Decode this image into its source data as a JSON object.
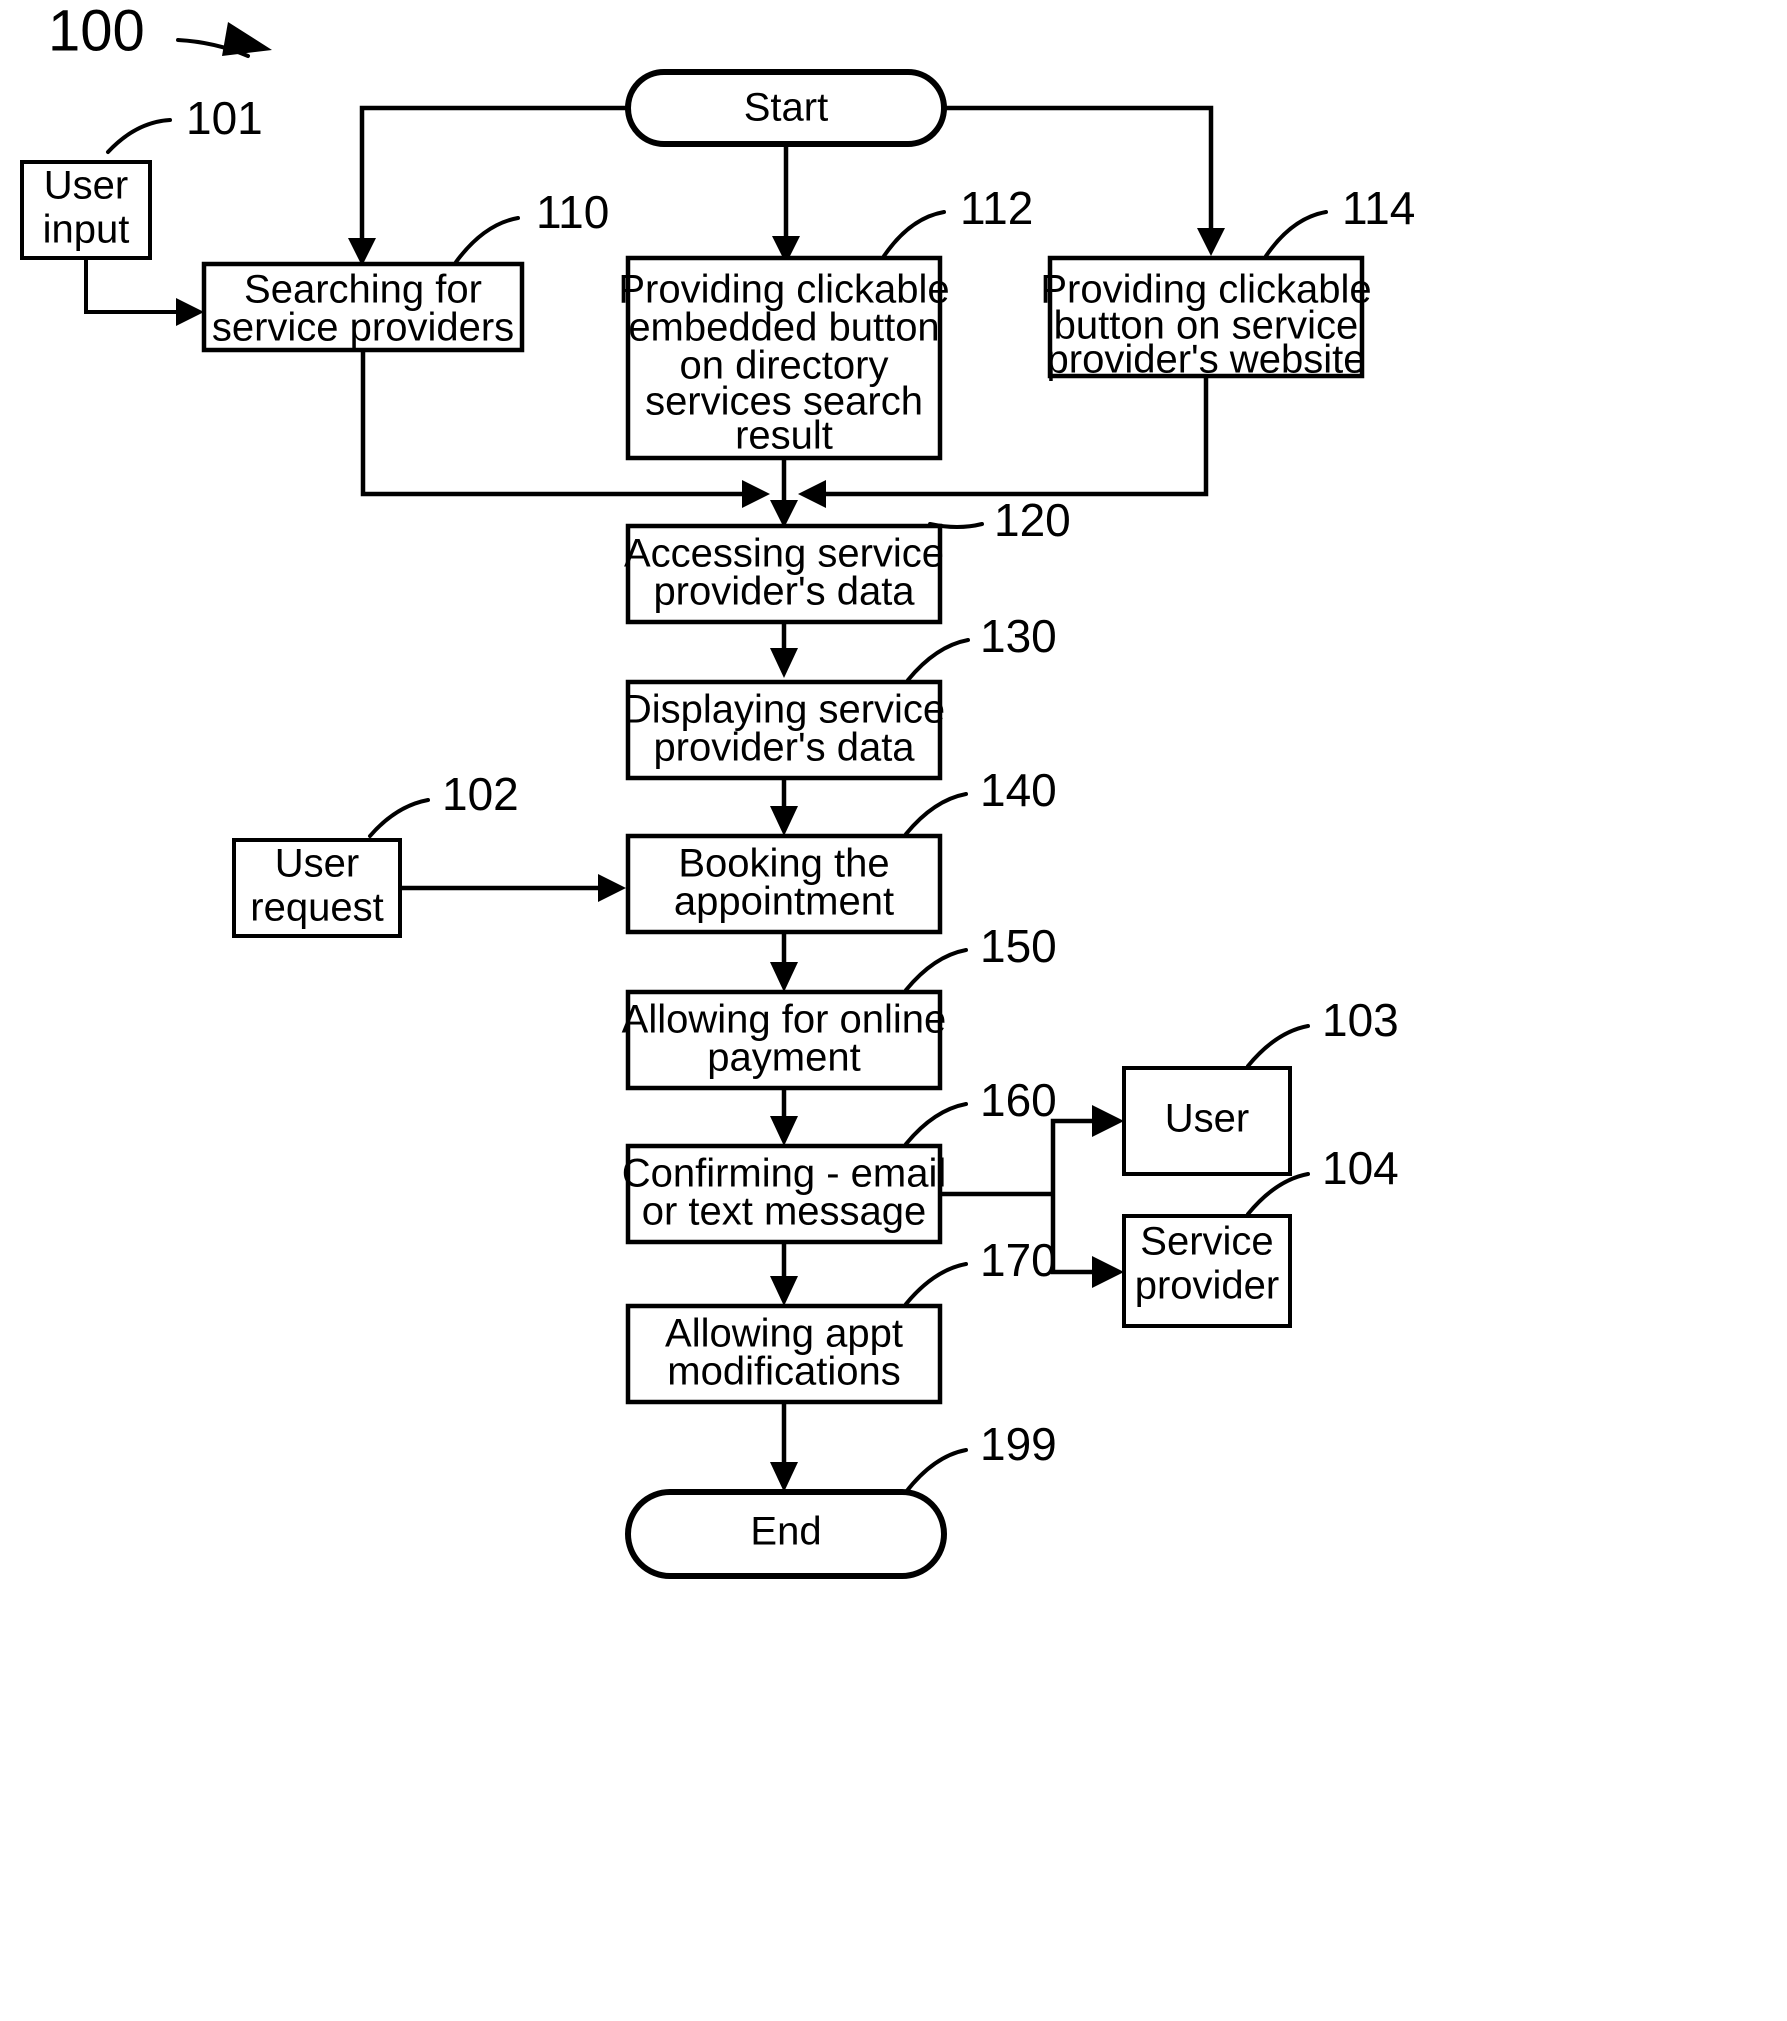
{
  "figure": {
    "number": "100",
    "title_marker": "100"
  },
  "terminals": [
    {
      "id": "start",
      "label": "Start",
      "ref": ""
    },
    {
      "id": "end",
      "label": "End",
      "ref": "199"
    }
  ],
  "nodes": [
    {
      "id": "user-input",
      "ref": "101",
      "lines": [
        "User",
        "input"
      ],
      "kind": "actor"
    },
    {
      "id": "searching-for-service-providers",
      "ref": "110",
      "lines": [
        "Searching for",
        "service providers"
      ],
      "kind": "process"
    },
    {
      "id": "providing-clickable-embedded-button",
      "ref": "112",
      "lines": [
        "Providing clickable",
        "embedded button",
        "on directory",
        "services search",
        "result"
      ],
      "kind": "process"
    },
    {
      "id": "providing-clickable-button-website",
      "ref": "114",
      "lines": [
        "Providing clickable",
        "button on service",
        "provider's website"
      ],
      "kind": "process"
    },
    {
      "id": "accessing-service-providers-data",
      "ref": "120",
      "lines": [
        "Accessing service",
        "provider's data"
      ],
      "kind": "process"
    },
    {
      "id": "displaying-service-providers-data",
      "ref": "130",
      "lines": [
        "Displaying service",
        "provider's data"
      ],
      "kind": "process"
    },
    {
      "id": "user-request",
      "ref": "102",
      "lines": [
        "User",
        "request"
      ],
      "kind": "actor"
    },
    {
      "id": "booking-the-appointment",
      "ref": "140",
      "lines": [
        "Booking the",
        "appointment"
      ],
      "kind": "process"
    },
    {
      "id": "allowing-for-online-payment",
      "ref": "150",
      "lines": [
        "Allowing for online",
        "payment"
      ],
      "kind": "process"
    },
    {
      "id": "confirming-email-or-text-message",
      "ref": "160",
      "lines": [
        "Confirming - email",
        "or text message"
      ],
      "kind": "process"
    },
    {
      "id": "allowing-appt-modifications",
      "ref": "170",
      "lines": [
        "Allowing appt",
        "modifications"
      ],
      "kind": "process"
    },
    {
      "id": "user-recipient",
      "ref": "103",
      "lines": [
        "User"
      ],
      "kind": "actor"
    },
    {
      "id": "service-provider-recipient",
      "ref": "104",
      "lines": [
        "Service",
        "provider"
      ],
      "kind": "actor"
    }
  ],
  "labels": {
    "fig100": "100",
    "ref101": "101",
    "ref102": "102",
    "ref103": "103",
    "ref104": "104",
    "ref110": "110",
    "ref112": "112",
    "ref114": "114",
    "ref120": "120",
    "ref130": "130",
    "ref140": "140",
    "ref150": "150",
    "ref160": "160",
    "ref170": "170",
    "ref199": "199",
    "start": "Start",
    "end": "End",
    "userInput_l1": "User",
    "userInput_l2": "input",
    "searching_l1": "Searching for",
    "searching_l2": "service providers",
    "embedded_l1": "Providing clickable",
    "embedded_l2": "embedded button",
    "embedded_l3": "on directory",
    "embedded_l4": "services search",
    "embedded_l5": "result",
    "website_l1": "Providing clickable",
    "website_l2": "button on service",
    "website_l3": "provider's website",
    "accessing_l1": "Accessing service",
    "accessing_l2": "provider's data",
    "displaying_l1": "Displaying service",
    "displaying_l2": "provider's data",
    "userRequest_l1": "User",
    "userRequest_l2": "request",
    "booking_l1": "Booking the",
    "booking_l2": "appointment",
    "payment_l1": "Allowing for online",
    "payment_l2": "payment",
    "confirming_l1": "Confirming - email",
    "confirming_l2": "or text message",
    "modifications_l1": "Allowing appt",
    "modifications_l2": "modifications",
    "userOut": "User",
    "spOut_l1": "Service",
    "spOut_l2": "provider"
  },
  "colors": {
    "ink": "#000000",
    "paper": "#ffffff"
  }
}
